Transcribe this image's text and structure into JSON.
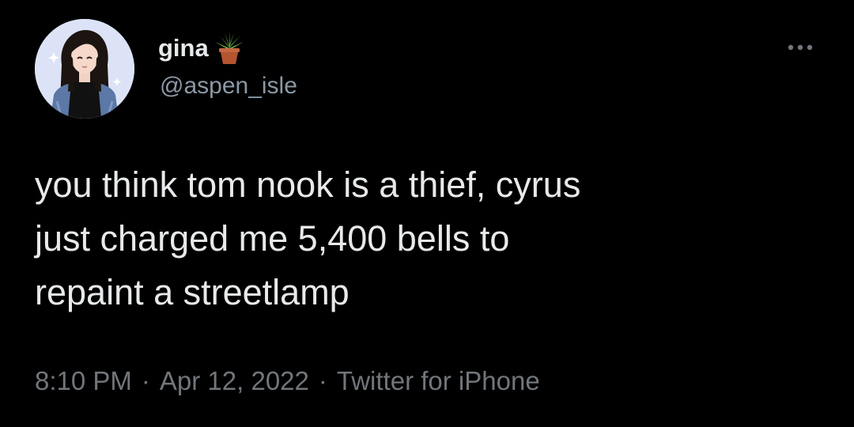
{
  "tweet": {
    "author": {
      "display_name": "gina",
      "handle": "@aspen_isle",
      "name_emoji_icon": "potted-plant-icon",
      "avatar_icon": "avatar-illustration"
    },
    "more_icon": "ellipsis-horizontal-icon",
    "text": "you think tom nook is a thief, cyrus\njust charged me 5,400 bells to\nrepaint a streetlamp",
    "time": "8:10 PM",
    "date": "Apr 12, 2022",
    "source": "Twitter for iPhone",
    "separator": "·"
  },
  "colors": {
    "background": "#000000",
    "primary_text": "#e7e9ea",
    "secondary_text": "#71767b",
    "handle_text": "#8b98a5",
    "avatar_bg": "#dde3f7"
  }
}
